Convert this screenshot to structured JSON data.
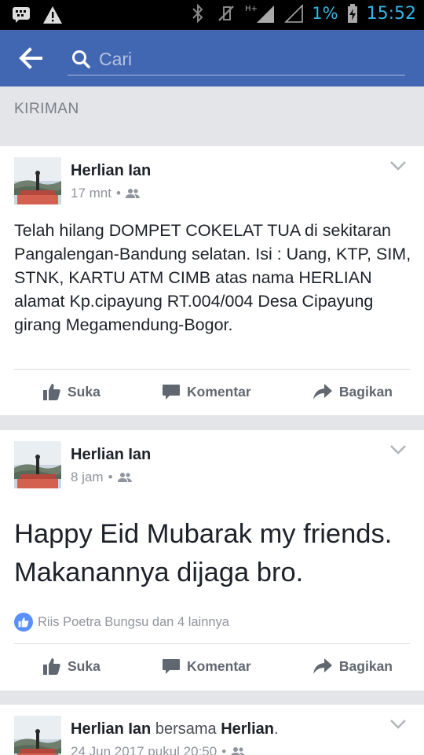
{
  "status_bar": {
    "battery_percent": "1%",
    "time": "15:52",
    "network_label": "H+",
    "accent_color": "#33b5e5"
  },
  "app_bar": {
    "color": "#4267b2",
    "back_icon": "arrow-left-icon",
    "search_icon": "search-icon",
    "search_placeholder": "Cari"
  },
  "section": {
    "title": "KIRIMAN"
  },
  "posts": [
    {
      "author": "Herlian Ian",
      "with_text": "",
      "with_author": "",
      "time": "17 mnt",
      "audience_icon": "friends-icon",
      "text": "Telah hilang DOMPET COKELAT TUA di sekitaran Pangalengan-Bandung selatan. Isi : Uang, KTP, SIM, STNK, KARTU ATM CIMB atas nama HERLIAN alamat Kp.cipayung RT.004/004 Desa Cipayung girang Megamendung-Bogor.",
      "reactions": "",
      "actions": {
        "like": "Suka",
        "comment": "Komentar",
        "share": "Bagikan"
      }
    },
    {
      "author": "Herlian Ian",
      "with_text": "",
      "with_author": "",
      "time": "8 jam",
      "audience_icon": "friends-icon",
      "text": "Happy Eid Mubarak my friends. Makanannya dijaga bro.",
      "reactions": "Riis Poetra Bungsu dan 4 lainnya",
      "actions": {
        "like": "Suka",
        "comment": "Komentar",
        "share": "Bagikan"
      }
    },
    {
      "author": "Herlian Ian",
      "with_text": "bersama",
      "with_author": "Herlian",
      "time": "24 Jun 2017 pukul 20:50",
      "audience_icon": "friends-icon"
    }
  ]
}
